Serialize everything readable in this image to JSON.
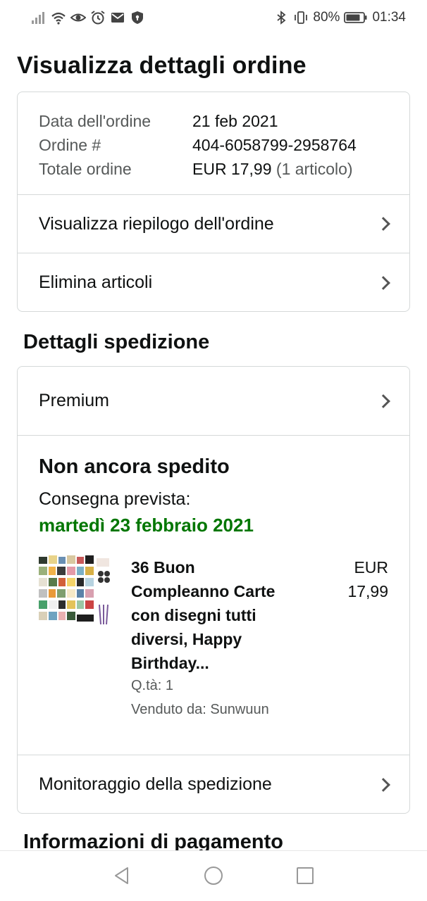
{
  "status_bar": {
    "battery": "80%",
    "time": "01:34",
    "icons_left": [
      "signal-icon",
      "wifi-icon",
      "eye-icon",
      "alarm-icon",
      "mail-icon",
      "shield-icon"
    ],
    "icons_right": [
      "bluetooth-icon",
      "vibrate-icon",
      "battery-icon"
    ]
  },
  "page": {
    "title": "Visualizza dettagli ordine"
  },
  "order_summary": {
    "date_label": "Data dell'ordine",
    "date_value": "21 feb 2021",
    "number_label": "Ordine #",
    "number_value": "404-6058799-2958764",
    "total_label": "Totale ordine",
    "total_value": "EUR 17,99",
    "total_items": "(1 articolo)"
  },
  "actions": {
    "view_summary": "Visualizza riepilogo dell'ordine",
    "delete_items": "Elimina articoli"
  },
  "shipping": {
    "section_title": "Dettagli spedizione",
    "method": "Premium",
    "status": "Non ancora spedito",
    "delivery_label": "Consegna prevista:",
    "delivery_date": "martedì 23 febbraio 2021",
    "tracking": "Monitoraggio della spedizione"
  },
  "product": {
    "title_lines": [
      "36 Buon",
      "Compleanno Carte",
      "con disegni tutti",
      "diversi, Happy",
      "Birthday..."
    ],
    "price_currency": "EUR",
    "price_value": "17,99",
    "qty": "Q.tà: 1",
    "seller": "Venduto da: Sunwuun"
  },
  "payment": {
    "section_title": "Informazioni di pagamento"
  },
  "colors": {
    "delivery_green": "#007600",
    "border": "#d5d9d9",
    "muted_text": "#565959"
  }
}
